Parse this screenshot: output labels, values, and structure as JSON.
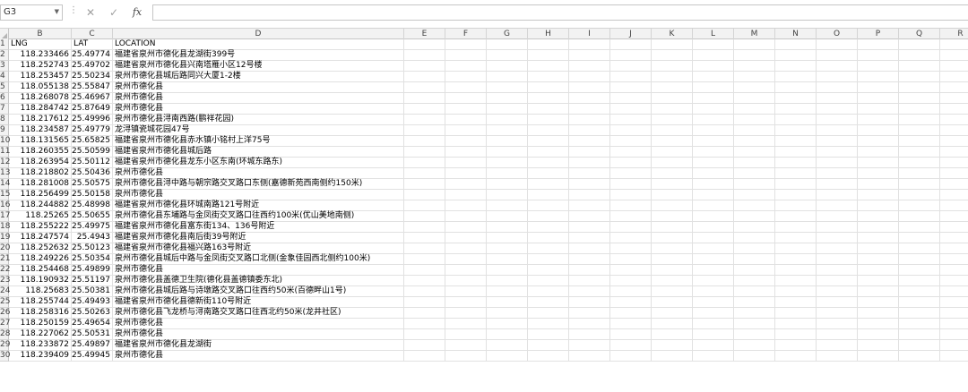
{
  "name_box": {
    "value": "G3"
  },
  "formula_bar": {
    "cancel_symbol": "✕",
    "enter_symbol": "✓",
    "fx_label": "fx",
    "value": ""
  },
  "columns": [
    "B",
    "C",
    "D",
    "E",
    "F",
    "G",
    "H",
    "I",
    "J",
    "K",
    "L",
    "M",
    "N",
    "O",
    "P",
    "Q",
    "R"
  ],
  "headers": {
    "row": "1",
    "b": "LNG",
    "c": "LAT",
    "d": "LOCATION"
  },
  "rows": [
    {
      "n": "2",
      "lng": "118.233466",
      "lat": "25.49774",
      "loc": "福建省泉州市德化县龙湖街399号"
    },
    {
      "n": "3",
      "lng": "118.252743",
      "lat": "25.49702",
      "loc": "福建省泉州市德化县兴南塔雁小区12号楼"
    },
    {
      "n": "4",
      "lng": "118.253457",
      "lat": "25.50234",
      "loc": "泉州市德化县城后路同兴大厦1-2楼"
    },
    {
      "n": "5",
      "lng": "118.055138",
      "lat": "25.55847",
      "loc": "泉州市德化县"
    },
    {
      "n": "6",
      "lng": "118.268078",
      "lat": "25.46967",
      "loc": "泉州市德化县"
    },
    {
      "n": "7",
      "lng": "118.284742",
      "lat": "25.87649",
      "loc": "泉州市德化县"
    },
    {
      "n": "8",
      "lng": "118.217612",
      "lat": "25.49996",
      "loc": "泉州市德化县浔南西路(鹏祥花园)"
    },
    {
      "n": "9",
      "lng": "118.234587",
      "lat": "25.49779",
      "loc": "龙浔镇瓷城花园47号"
    },
    {
      "n": "10",
      "lng": "118.131565",
      "lat": "25.65825",
      "loc": "福建省泉州市德化县赤水镇小铭村上洋75号"
    },
    {
      "n": "11",
      "lng": "118.260355",
      "lat": "25.50599",
      "loc": "福建省泉州市德化县城后路"
    },
    {
      "n": "12",
      "lng": "118.263954",
      "lat": "25.50112",
      "loc": "福建省泉州市德化县龙东小区东南(环城东路东)"
    },
    {
      "n": "13",
      "lng": "118.218802",
      "lat": "25.50436",
      "loc": "泉州市德化县"
    },
    {
      "n": "14",
      "lng": "118.281008",
      "lat": "25.50575",
      "loc": "泉州市德化县浔中路与朝宗路交叉路口东侧(嘉德新苑西南侧约150米)"
    },
    {
      "n": "15",
      "lng": "118.256499",
      "lat": "25.50158",
      "loc": "泉州市德化县"
    },
    {
      "n": "16",
      "lng": "118.244882",
      "lat": "25.48998",
      "loc": "福建省泉州市德化县环城南路121号附近"
    },
    {
      "n": "17",
      "lng": "118.25265",
      "lat": "25.50655",
      "loc": "泉州市德化县东埔路与金凤街交叉路口往西约100米(优山美地南侧)"
    },
    {
      "n": "18",
      "lng": "118.255222",
      "lat": "25.49975",
      "loc": "福建省泉州市德化县富东街134、136号附近"
    },
    {
      "n": "19",
      "lng": "118.247574",
      "lat": "25.4943",
      "loc": "福建省泉州市德化县南后街39号附近"
    },
    {
      "n": "20",
      "lng": "118.252632",
      "lat": "25.50123",
      "loc": "福建省泉州市德化县福兴路163号附近"
    },
    {
      "n": "21",
      "lng": "118.249226",
      "lat": "25.50354",
      "loc": "泉州市德化县城后中路与金凤街交叉路口北侧(金象佳园西北侧约100米)"
    },
    {
      "n": "22",
      "lng": "118.254468",
      "lat": "25.49899",
      "loc": "泉州市德化县"
    },
    {
      "n": "23",
      "lng": "118.190932",
      "lat": "25.51197",
      "loc": "泉州市德化县盖德卫生院(德化县盖德镇委东北)"
    },
    {
      "n": "24",
      "lng": "118.25683",
      "lat": "25.50381",
      "loc": "泉州市德化县城后路与诗墩路交叉路口往西约50米(百德畔山1号)"
    },
    {
      "n": "25",
      "lng": "118.255744",
      "lat": "25.49493",
      "loc": "福建省泉州市德化县德新街110号附近"
    },
    {
      "n": "26",
      "lng": "118.258316",
      "lat": "25.50263",
      "loc": "泉州市德化县飞龙桥与浔南路交叉路口往西北约50米(龙井社区)"
    },
    {
      "n": "27",
      "lng": "118.250159",
      "lat": "25.49654",
      "loc": "泉州市德化县"
    },
    {
      "n": "28",
      "lng": "118.227062",
      "lat": "25.50531",
      "loc": "泉州市德化县"
    },
    {
      "n": "29",
      "lng": "118.233872",
      "lat": "25.49897",
      "loc": "福建省泉州市德化县龙湖街"
    },
    {
      "n": "30",
      "lng": "118.239409",
      "lat": "25.49945",
      "loc": "泉州市德化县"
    }
  ]
}
